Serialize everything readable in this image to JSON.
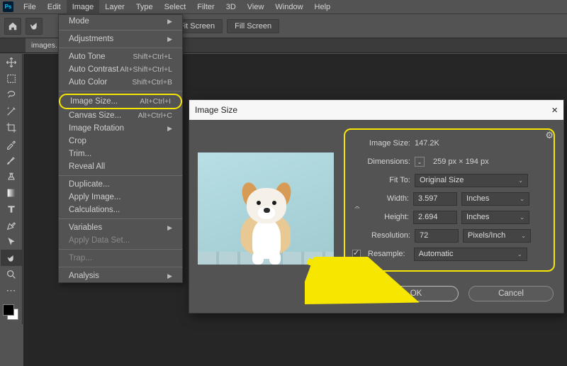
{
  "menubar": {
    "items": [
      "File",
      "Edit",
      "Image",
      "Layer",
      "Type",
      "Select",
      "Filter",
      "3D",
      "View",
      "Window",
      "Help"
    ],
    "active": "Image",
    "logo": "Ps"
  },
  "optionsbar": {
    "fit_screen": "Fit Screen",
    "fill_screen": "Fill Screen"
  },
  "tabs": {
    "doc": "images."
  },
  "dropdown": {
    "mode": "Mode",
    "adjustments": "Adjustments",
    "auto_tone": "Auto Tone",
    "auto_tone_sc": "Shift+Ctrl+L",
    "auto_contrast": "Auto Contrast",
    "auto_contrast_sc": "Alt+Shift+Ctrl+L",
    "auto_color": "Auto Color",
    "auto_color_sc": "Shift+Ctrl+B",
    "image_size": "Image Size...",
    "image_size_sc": "Alt+Ctrl+I",
    "canvas_size": "Canvas Size...",
    "canvas_size_sc": "Alt+Ctrl+C",
    "image_rotation": "Image Rotation",
    "crop": "Crop",
    "trim": "Trim...",
    "reveal_all": "Reveal All",
    "duplicate": "Duplicate...",
    "apply_image": "Apply Image...",
    "calculations": "Calculations...",
    "variables": "Variables",
    "apply_data_set": "Apply Data Set...",
    "trap": "Trap...",
    "analysis": "Analysis"
  },
  "dialog": {
    "title": "Image Size",
    "size_lbl": "Image Size:",
    "size_val": "147.2K",
    "dim_lbl": "Dimensions:",
    "dim_val": "259 px  ×  194 px",
    "fit_lbl": "Fit To:",
    "fit_val": "Original Size",
    "width_lbl": "Width:",
    "width_val": "3.597",
    "width_unit": "Inches",
    "height_lbl": "Height:",
    "height_val": "2.694",
    "height_unit": "Inches",
    "res_lbl": "Resolution:",
    "res_val": "72",
    "res_unit": "Pixels/Inch",
    "resample_lbl": "Resample:",
    "resample_val": "Automatic",
    "ok": "OK",
    "cancel": "Cancel"
  }
}
